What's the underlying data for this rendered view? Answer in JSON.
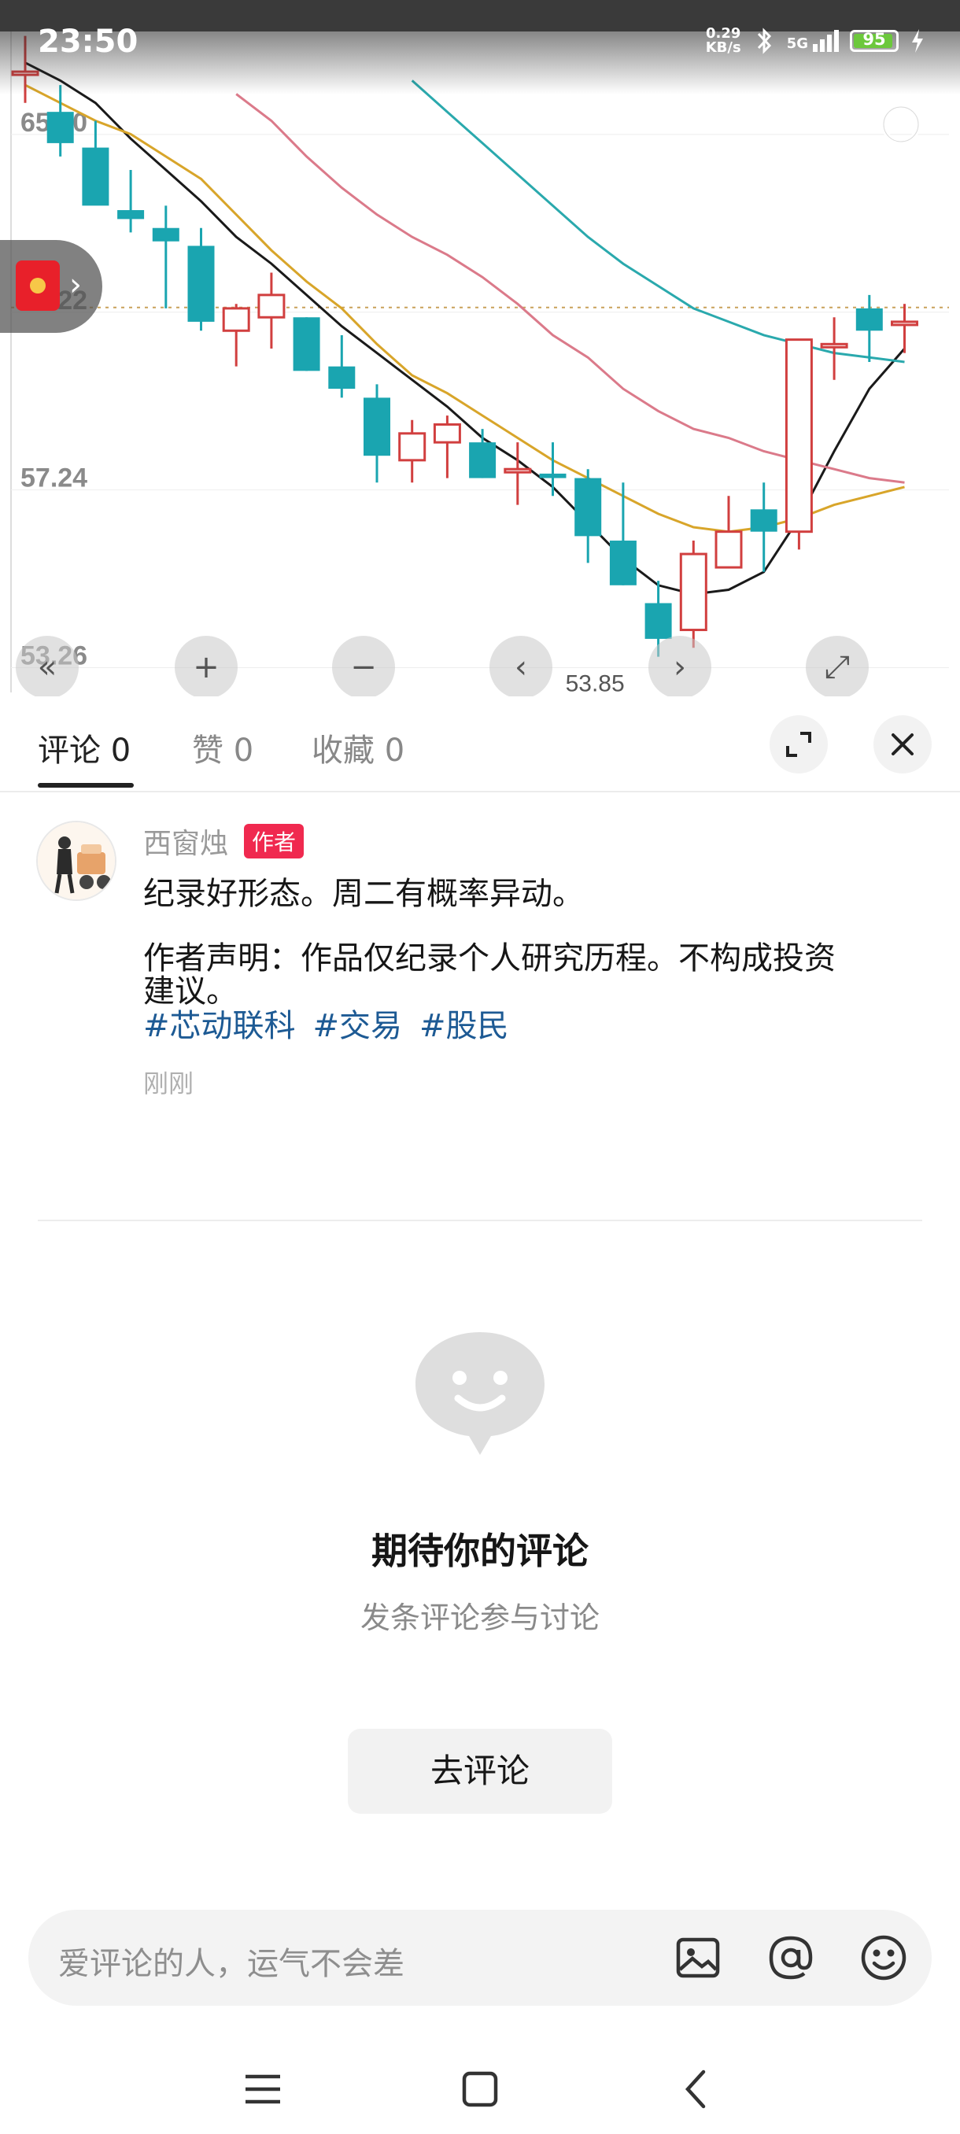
{
  "status_bar": {
    "time": "23:50",
    "net_speed_value": "0.29",
    "net_speed_unit": "KB/s",
    "signal": "5G",
    "battery": "95",
    "battery_level": 0.95
  },
  "chart": {
    "y_labels": [
      "65.20",
      "61.22",
      "57.24",
      "53.26"
    ],
    "low_label": "53.85",
    "colors": {
      "up": "#d13f3f",
      "down": "#1aa5b0",
      "ma5": "#1a1a1a",
      "ma10": "#d8a52a",
      "ma20": "#db7a8a",
      "ma30": "#2aa9ad"
    }
  },
  "chart_data": {
    "type": "candlestick",
    "ylim": [
      52.6,
      67.4
    ],
    "y_ticks": [
      65.2,
      61.22,
      57.24,
      53.26
    ],
    "reference_line": 61.22,
    "candles": [
      {
        "o": 66.5,
        "h": 67.3,
        "l": 65.8,
        "c": 66.5
      },
      {
        "o": 65.6,
        "h": 66.2,
        "l": 64.6,
        "c": 64.9
      },
      {
        "o": 64.8,
        "h": 65.4,
        "l": 63.8,
        "c": 63.5
      },
      {
        "o": 63.4,
        "h": 64.3,
        "l": 62.9,
        "c": 63.2
      },
      {
        "o": 63.0,
        "h": 63.5,
        "l": 61.2,
        "c": 62.7
      },
      {
        "o": 62.6,
        "h": 63.0,
        "l": 60.7,
        "c": 60.9
      },
      {
        "o": 60.7,
        "h": 61.3,
        "l": 59.9,
        "c": 61.2
      },
      {
        "o": 61.0,
        "h": 62.0,
        "l": 60.3,
        "c": 61.5
      },
      {
        "o": 61.0,
        "h": 61.0,
        "l": 59.8,
        "c": 59.8
      },
      {
        "o": 59.9,
        "h": 60.6,
        "l": 59.2,
        "c": 59.4
      },
      {
        "o": 59.2,
        "h": 59.5,
        "l": 57.3,
        "c": 57.9
      },
      {
        "o": 57.8,
        "h": 58.7,
        "l": 57.3,
        "c": 58.4
      },
      {
        "o": 58.2,
        "h": 58.8,
        "l": 57.4,
        "c": 58.6
      },
      {
        "o": 58.2,
        "h": 58.5,
        "l": 57.4,
        "c": 57.4
      },
      {
        "o": 57.6,
        "h": 58.2,
        "l": 56.8,
        "c": 57.6
      },
      {
        "o": 57.5,
        "h": 58.2,
        "l": 57.0,
        "c": 57.4
      },
      {
        "o": 57.4,
        "h": 57.6,
        "l": 55.5,
        "c": 56.1
      },
      {
        "o": 56.0,
        "h": 57.3,
        "l": 55.0,
        "c": 55.0
      },
      {
        "o": 54.6,
        "h": 55.1,
        "l": 53.4,
        "c": 53.8
      },
      {
        "o": 54.0,
        "h": 56.0,
        "l": 53.6,
        "c": 55.7
      },
      {
        "o": 55.4,
        "h": 57.0,
        "l": 55.4,
        "c": 56.2
      },
      {
        "o": 56.7,
        "h": 57.3,
        "l": 55.3,
        "c": 56.2
      },
      {
        "o": 56.2,
        "h": 59.4,
        "l": 55.8,
        "c": 60.5
      },
      {
        "o": 60.4,
        "h": 61.0,
        "l": 59.6,
        "c": 60.4
      },
      {
        "o": 61.2,
        "h": 61.5,
        "l": 60.0,
        "c": 60.7
      },
      {
        "o": 60.9,
        "h": 61.3,
        "l": 60.2,
        "c": 60.9
      }
    ],
    "series": [
      {
        "values": [
          66.7,
          66.3,
          65.8,
          65.0,
          64.3,
          63.6,
          62.8,
          62.2,
          61.5,
          60.8,
          60.2,
          59.6,
          59.0,
          58.3,
          57.8,
          57.2,
          56.4,
          55.6,
          55.0,
          54.8,
          54.9,
          55.3,
          56.5,
          58.0,
          59.4,
          60.3
        ]
      },
      {
        "values": [
          66.2,
          65.8,
          65.4,
          65.1,
          64.6,
          64.1,
          63.3,
          62.5,
          61.8,
          61.2,
          60.4,
          59.7,
          59.3,
          58.8,
          58.3,
          57.8,
          57.4,
          57.0,
          56.6,
          56.3,
          56.2,
          56.3,
          56.5,
          56.8,
          57.0,
          57.2
        ]
      },
      {
        "series_hint": "",
        "values": [
          null,
          null,
          null,
          null,
          null,
          null,
          66.0,
          65.4,
          64.6,
          63.9,
          63.3,
          62.8,
          62.4,
          61.9,
          61.3,
          60.6,
          60.1,
          59.4,
          58.9,
          58.5,
          58.3,
          58.0,
          57.8,
          57.6,
          57.4,
          57.3
        ]
      },
      {
        "values": [
          null,
          null,
          null,
          null,
          null,
          null,
          null,
          null,
          null,
          null,
          null,
          66.3,
          65.6,
          64.9,
          64.2,
          63.5,
          62.8,
          62.2,
          61.7,
          61.2,
          60.9,
          60.6,
          60.4,
          60.2,
          60.1,
          60.0
        ]
      }
    ]
  },
  "chart_controls": [
    "«",
    "+",
    "−",
    "‹",
    "›",
    "⤢"
  ],
  "tabs": [
    {
      "label": "评论",
      "count": "0"
    },
    {
      "label": "赞",
      "count": "0"
    },
    {
      "label": "收藏",
      "count": "0"
    }
  ],
  "comment": {
    "author": "西窗烛",
    "author_tag": "作者",
    "line1": "纪录好形态。周二有概率异动。",
    "line2": "作者声明：作品仅纪录个人研究历程。不构成投资",
    "line3": "建议。",
    "tags": [
      "#芯动联科",
      "#交易",
      "#股民"
    ],
    "time": "刚刚"
  },
  "empty_state": {
    "title": "期待你的评论",
    "subtitle": "发条评论参与讨论",
    "button": "去评论"
  },
  "input": {
    "placeholder": "爱评论的人，运气不会差"
  },
  "icons": {
    "image": "image-icon",
    "at": "at-icon",
    "emoji": "emoji-icon"
  }
}
